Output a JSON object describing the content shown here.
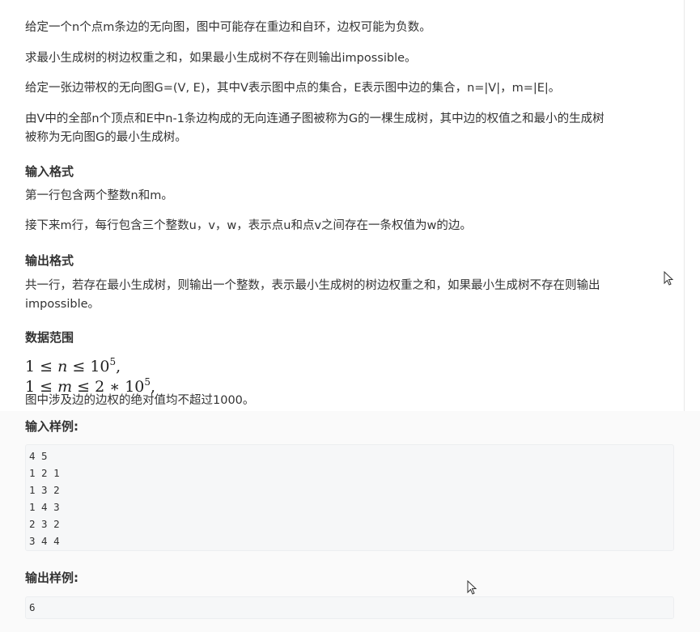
{
  "problem": {
    "intro": [
      "给定一个n个点m条边的无向图，图中可能存在重边和自环，边权可能为负数。",
      "求最小生成树的树边权重之和，如果最小生成树不存在则输出impossible。",
      "给定一张边带权的无向图G=(V, E)，其中V表示图中点的集合，E表示图中边的集合，n=|V|，m=|E|。",
      "由V中的全部n个顶点和E中n-1条边构成的无向连通子图被称为G的一棵生成树，其中边的权值之和最小的生成树",
      "被称为无向图G的最小生成树。"
    ]
  },
  "input_format": {
    "heading": "输入格式",
    "lines": [
      "第一行包含两个整数n和m。",
      "接下来m行，每行包含三个整数u，v，w，表示点u和点v之间存在一条权值为w的边。"
    ]
  },
  "output_format": {
    "heading": "输出格式",
    "lines": [
      "共一行，若存在最小生成树，则输出一个整数，表示最小生成树的树边权重之和，如果最小生成树不存在则输出",
      "impossible。"
    ]
  },
  "data_range": {
    "heading": "数据范围",
    "note": "图中涉及边的边权的绝对值均不超过1000。"
  },
  "sample_input": {
    "heading": "输入样例:",
    "lines": [
      "4 5",
      "1 2 1",
      "1 3 2",
      "1 4 3",
      "2 3 2",
      "3 4 4"
    ]
  },
  "sample_output": {
    "heading": "输出样例:",
    "lines": [
      "6"
    ]
  }
}
